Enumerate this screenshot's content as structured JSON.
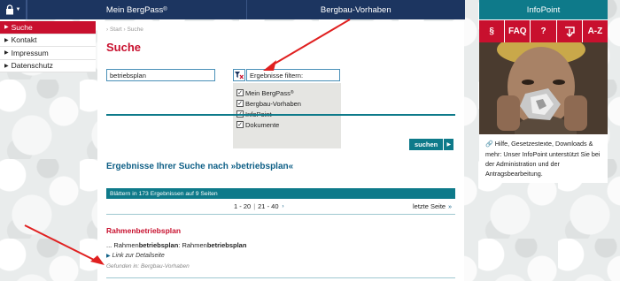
{
  "topbar": {
    "nav": [
      {
        "label": "Mein BergPass",
        "sup": "®"
      },
      {
        "label": "Bergbau-Vorhaben",
        "sup": ""
      }
    ]
  },
  "sidebar": {
    "items": [
      {
        "label": "Suche",
        "active": true
      },
      {
        "label": "Kontakt",
        "active": false
      },
      {
        "label": "Impressum",
        "active": false
      },
      {
        "label": "Datenschutz",
        "active": false
      }
    ]
  },
  "breadcrumb": "› Start  › Suche",
  "page_title": "Suche",
  "search": {
    "value": "betriebsplan",
    "filter_value": "Ergebnisse filtern:",
    "filter_options": [
      {
        "label": "Mein BergPass",
        "sup": "®",
        "checked": true
      },
      {
        "label": "Bergbau-Vorhaben",
        "sup": "",
        "checked": true
      },
      {
        "label": "InfoPoint",
        "sup": "",
        "checked": true
      },
      {
        "label": "Dokumente",
        "sup": "",
        "checked": true
      }
    ],
    "submit_label": "suchen"
  },
  "results": {
    "heading": "Ergebnisse Ihrer Suche nach »betriebsplan«",
    "summary": "Blättern in 173 Ergebnissen auf 9 Seiten",
    "pages": {
      "current": "1 - 20",
      "next": "21 - 40"
    },
    "last_page_label": "letzte Seite",
    "items": [
      {
        "title": "Rahmenbetriebsplan",
        "snippet_prefix": "... Rahmen",
        "snippet_bold1": "betriebsplan",
        "snippet_mid": ": Rahmen",
        "snippet_bold2": "betriebsplan",
        "detail_link": "Link zur Detailseite",
        "found_in": "Gefunden in: Bergbau-Vorhaben"
      }
    ]
  },
  "infopoint": {
    "title": "InfoPoint",
    "icons": [
      {
        "label": "§",
        "name": "paragraph-icon"
      },
      {
        "label": "FAQ",
        "name": "faq-icon"
      },
      {
        "label": "?",
        "name": "help-icon"
      },
      {
        "label": "",
        "name": "download-icon"
      },
      {
        "label": "A-Z",
        "name": "a-z-icon"
      }
    ],
    "text": "Hilfe, Gesetzestexte, Downloads & mehr: Unser InfoPoint unterstützt Sie bei der Administration und der Antragsbearbeitung."
  },
  "colors": {
    "navy": "#1c3560",
    "red": "#c8102e",
    "teal": "#0e7a8a"
  }
}
